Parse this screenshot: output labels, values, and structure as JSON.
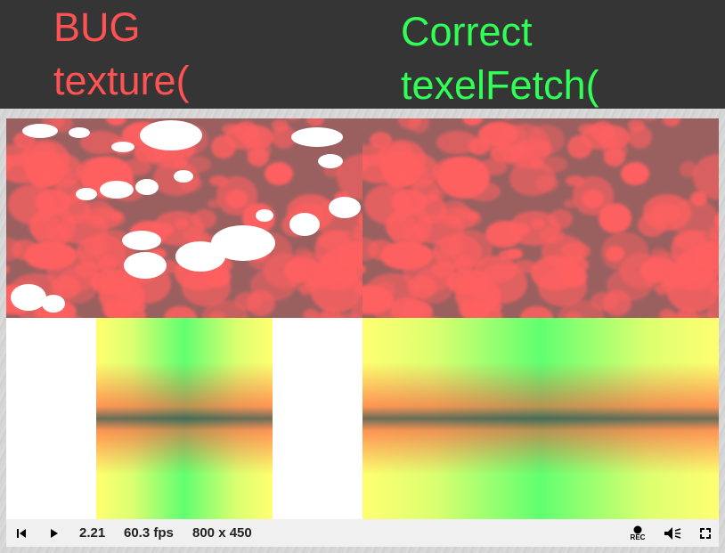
{
  "header": {
    "left_line1": "BUG",
    "left_line2": "texture(",
    "right_line1": "Correct",
    "right_line2": "texelFetch("
  },
  "colors": {
    "bug_red": "#ff5252",
    "correct_green": "#30ff55",
    "header_bg": "#353535",
    "pebble_red": "#ff6060",
    "gradient_yellow": "#ffff70",
    "gradient_green": "#60ff70"
  },
  "player": {
    "time": "2.21",
    "fps": "60.3 fps",
    "resolution": "800 x 450",
    "rec_label": "REC",
    "icons": [
      "skip-back-icon",
      "play-icon",
      "record-icon",
      "volume-icon",
      "fullscreen-icon"
    ]
  }
}
